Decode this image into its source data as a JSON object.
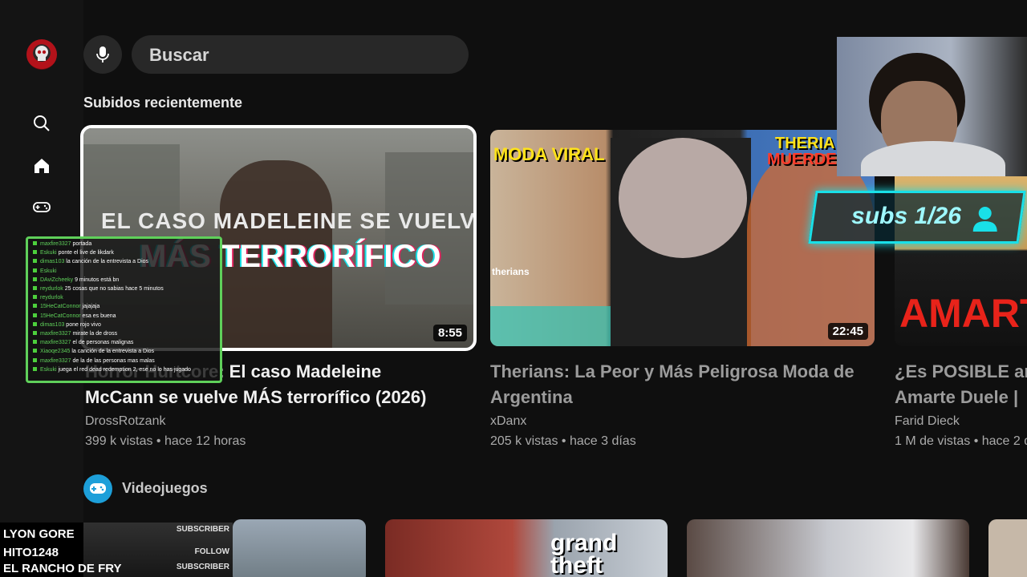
{
  "sidebar": {
    "items": [
      {
        "name": "search",
        "icon": "search-icon"
      },
      {
        "name": "home",
        "icon": "home-icon"
      },
      {
        "name": "gaming",
        "icon": "gamepad-icon"
      }
    ]
  },
  "search": {
    "placeholder": "Buscar"
  },
  "section_recent": {
    "title": "Subidos recientemente"
  },
  "videos": [
    {
      "thumb_text_line1": "EL CASO MADELEINE SE VUELVE",
      "thumb_text_line2": "MÁS TERRORÍFICO",
      "duration": "8:55",
      "title_line1": "Horror Hurtcore: El caso Madeleine",
      "title_line2": "McCann se vuelve MÁS terrorífico (2026)",
      "channel": "DrossRotzank",
      "meta": "399 k vistas • hace 12 horas"
    },
    {
      "thumb_text_left": "MODA VIRAL",
      "thumb_text_right1": "THERIA",
      "thumb_text_right2": "MUERDE A",
      "thumb_caption": "therians",
      "duration": "22:45",
      "title_line1": "Therians: La Peor y Más Peligrosa Moda de",
      "title_line2": "Argentina",
      "channel": "xDanx",
      "meta": "205 k vistas • hace 3 días"
    },
    {
      "thumb_text": "AMART",
      "title_line1": "¿Es POSIBLE ar",
      "title_line2": "Amarte Duele |",
      "channel": "Farid Dieck",
      "meta": "1 M de vistas • hace 2 d"
    }
  ],
  "overlay": {
    "subs_counter": "subs 1/26",
    "chat": [
      {
        "user": "maxfire3327",
        "text": "portada"
      },
      {
        "user": "Eskuki",
        "text": "ponte el live de likdark"
      },
      {
        "user": "dimas103",
        "text": "la canción de la entrevista a Dios"
      },
      {
        "user": "Eskuki",
        "text": ""
      },
      {
        "user": "DAviZcheeky",
        "text": "9 minutos está bn"
      },
      {
        "user": "reydurlok",
        "text": "25 cosas que no sabias hace 5 minutos"
      },
      {
        "user": "reydurlok",
        "text": ""
      },
      {
        "user": "15HeCatConnor",
        "text": "jajajaja"
      },
      {
        "user": "15HeCatConnor",
        "text": "esa es buena"
      },
      {
        "user": "dimas103",
        "text": "pone rojo vivo"
      },
      {
        "user": "maxfire3327",
        "text": "mirate la de dross"
      },
      {
        "user": "maxfire3327",
        "text": "el de personas malignas"
      },
      {
        "user": "Xiaoqe2345",
        "text": "la canción de la entrevista a Dios"
      },
      {
        "user": "maxfire3327",
        "text": "de la de las personas mas malas"
      },
      {
        "user": "Eskuki",
        "text": "juega el red dead redemption 2, ese no lo has jugado"
      }
    ],
    "follow_events": [
      {
        "name": "LYON GORE",
        "action": "SUBSCRIBER"
      },
      {
        "name": "HITO1248",
        "action": "FOLLOW"
      },
      {
        "name": "EL RANCHO DE FRY",
        "action": "SUBSCRIBER"
      }
    ]
  },
  "section_games": {
    "title": "Videojuegos",
    "icon": "gamepad-icon"
  },
  "games_row": [
    {
      "thumb_text": ""
    },
    {
      "thumb_text": "grand theft"
    },
    {
      "thumb_text": ""
    }
  ],
  "colors": {
    "accent_cyan": "#19e0e8",
    "chat_green": "#5fd05a",
    "games_blue": "#1d9fd9"
  }
}
